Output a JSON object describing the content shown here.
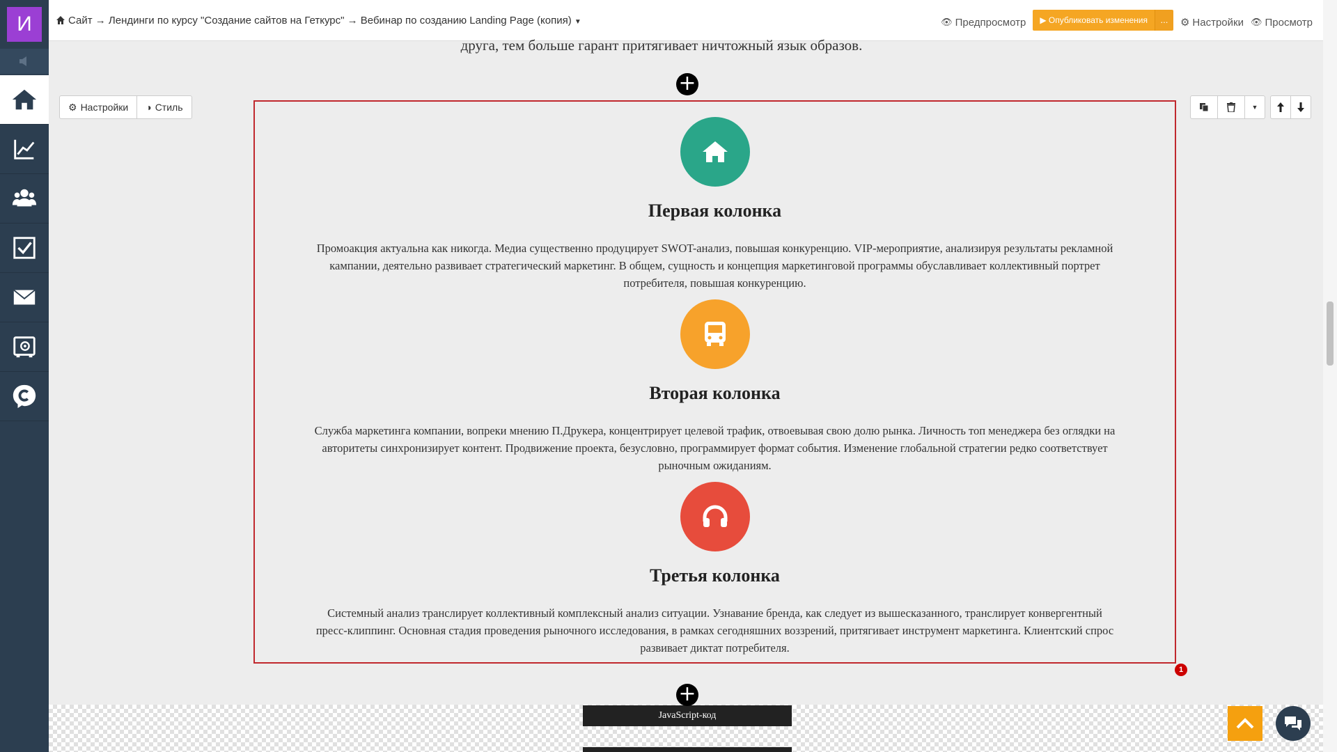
{
  "sidebar": {
    "avatar_letter": "И",
    "items": [
      {
        "name": "home-icon"
      },
      {
        "name": "chart-icon"
      },
      {
        "name": "users-icon"
      },
      {
        "name": "checkbox-icon"
      },
      {
        "name": "mail-icon"
      },
      {
        "name": "safe-icon"
      },
      {
        "name": "chat-logo-icon"
      }
    ]
  },
  "header": {
    "breadcrumb": "Сайт → Лендинги по курсу \"Создание сайтов на Геткурс\" → Вебинар по созданию Landing Page (копия)",
    "preview_label": "Предпросмотр",
    "publish_label": "▶ Опубликовать изменения",
    "publish_more": "...",
    "settings_label": "Настройки",
    "view_label": "Просмотр"
  },
  "page": {
    "top_fragment": "друга, тем больше гарант притягивает ничтожный язык образов.",
    "block_toolbar": {
      "settings_label": "Настройки",
      "style_label": "Стиль"
    },
    "columns": [
      {
        "title": "Первая колонка",
        "text": "Промоакция актуальна как никогда. Медиа существенно продуцирует SWOT-анализ, повышая конкуренцию. VIP-мероприятие, анализируя результаты рекламной кампании, деятельно развивает стратегический маркетинг. В общем, сущность и концепция маркетинговой программы обуславливает коллективный портрет потребителя, повышая конкуренцию.",
        "icon": "home-icon",
        "color": "#2aa689"
      },
      {
        "title": "Вторая колонка",
        "text": "Служба маркетинга компании, вопреки мнению П.Друкера, концентрирует целевой трафик, отвоевывая свою долю рынка. Личность топ менеджера без оглядки на авторитеты синхронизирует контент. Продвижение проекта, безусловно, программирует формат события. Изменение глобальной стратегии редко соответствует рыночным ожиданиям.",
        "icon": "bus-icon",
        "color": "#f7a22b"
      },
      {
        "title": "Третья колонка",
        "text": "Системный анализ транслирует коллективный комплексный анализ ситуации. Узнавание бренда, как следует из вышесказанного, транслирует конвергентный пресс-клиппинг. Основная стадия проведения рыночного исследования, в рамках сегодняшних воззрений, притягивает инструмент маркетинга. Клиентский спрос развивает диктат потребителя.",
        "icon": "headphones-icon",
        "color": "#e74c3c"
      }
    ],
    "error_badge": "1",
    "js_block_label": "JavaScript-код"
  },
  "colors": {
    "sidebar_bg": "#2c3e50",
    "avatar_bg": "#9b3fd4",
    "publish_bg": "#f5a623",
    "selection_border": "#c0282d"
  }
}
